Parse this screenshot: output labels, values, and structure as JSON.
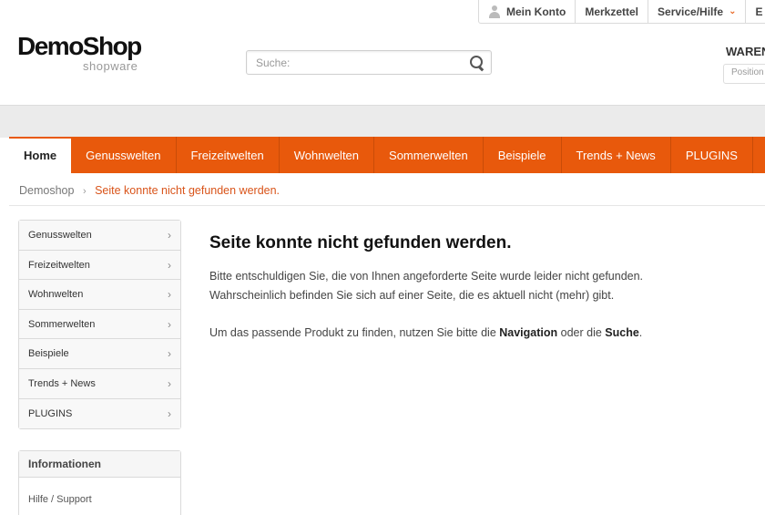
{
  "topbar": {
    "account": "Mein Konto",
    "wishlist": "Merkzettel",
    "service": "Service/Hilfe",
    "cutoff": "E"
  },
  "logo": {
    "main": "DemoShop",
    "sub": "shopware"
  },
  "search": {
    "placeholder": "Suche:"
  },
  "cart": {
    "label": "WAREN",
    "positions": "Position"
  },
  "nav": {
    "items": [
      "Home",
      "Genusswelten",
      "Freizeitwelten",
      "Wohnwelten",
      "Sommerwelten",
      "Beispiele",
      "Trends + News",
      "PLUGINS"
    ]
  },
  "breadcrumb": {
    "root": "Demoshop",
    "separator": "›",
    "current": "Seite konnte nicht gefunden werden."
  },
  "sidebar": {
    "items": [
      "Genusswelten",
      "Freizeitwelten",
      "Wohnwelten",
      "Sommerwelten",
      "Beispiele",
      "Trends + News",
      "PLUGINS"
    ],
    "arrow": "›",
    "info_title": "Informationen",
    "info_link": "Hilfe / Support"
  },
  "main": {
    "title": "Seite konnte nicht gefunden werden.",
    "line1": "Bitte entschuldigen Sie, die von Ihnen angeforderte Seite wurde leider nicht gefunden.",
    "line2": "Wahrscheinlich befinden Sie sich auf einer Seite, die es aktuell nicht (mehr) gibt.",
    "p2_prefix": "Um das passende Produkt zu finden, nutzen Sie bitte die ",
    "p2_nav": "Navigation",
    "p2_mid": " oder die ",
    "p2_search": "Suche",
    "p2_suffix": "."
  },
  "colors": {
    "accent": "#e8590c",
    "breadcrumb_active": "#d9541a"
  }
}
